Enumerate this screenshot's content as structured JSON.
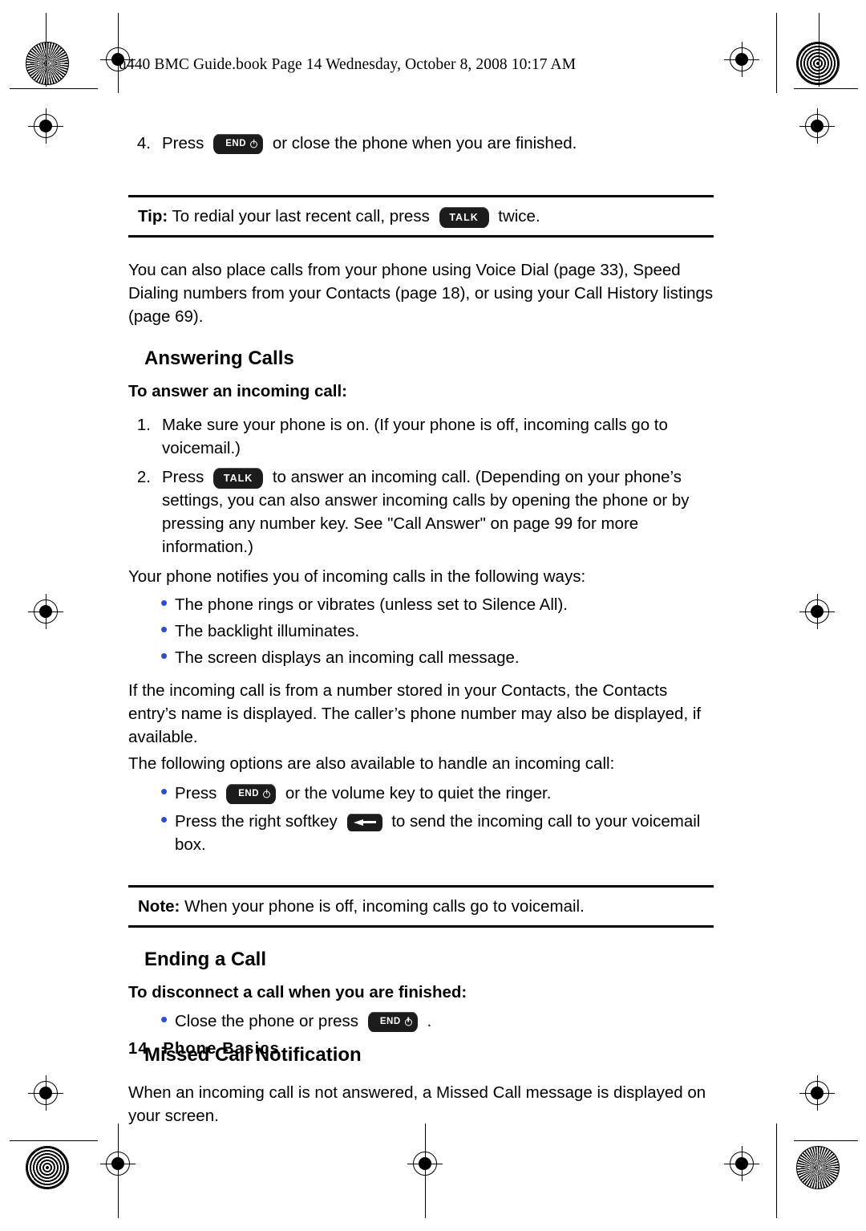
{
  "header": {
    "file_line": "u440 BMC Guide.book  Page 14  Wednesday, October 8, 2008  10:17 AM"
  },
  "content": {
    "step4": {
      "number": "4.",
      "text_before": "Press",
      "key": "END",
      "text_after": "or close the phone when you are finished."
    },
    "tip": {
      "label": "Tip:",
      "text_before": "To redial your last recent call, press",
      "key": "TALK",
      "text_after": "twice."
    },
    "intro_paragraph": "You can also place calls from your phone using Voice Dial (page 33), Speed Dialing numbers from your Contacts (page 18), or using your Call History listings (page 69).",
    "answering_calls_heading": "Answering Calls",
    "to_answer_subheading": "To answer an incoming call:",
    "answer_steps": [
      {
        "number": "1.",
        "text": "Make sure your phone is on. (If your phone is off, incoming calls go to voicemail.)"
      },
      {
        "number": "2.",
        "text_before": "Press",
        "key": "TALK",
        "text_after": "to answer an incoming call. (Depending on your phone’s settings, you can also answer incoming calls by opening the phone or by pressing any number key. See \"Call Answer\" on page 99 for more information.)"
      }
    ],
    "notify_lead": "Your phone notifies you of incoming calls in the following ways:",
    "notify_bullets": [
      "The phone rings or vibrates (unless set to Silence All).",
      "The backlight illuminates.",
      "The screen displays an incoming call message."
    ],
    "contacts_paragraph": "If the incoming call is from a number stored in your Contacts, the Contacts entry’s name is displayed. The caller’s phone number may also be displayed, if available.",
    "options_lead": "The following options are also available to handle an incoming call:",
    "option_bullets": [
      {
        "text_before": "Press",
        "key": "END",
        "text_after": "or the volume key to quiet the ringer."
      },
      {
        "text_before": "Press the right softkey",
        "key": "SOFTKEY",
        "text_after": "to send the incoming call to your voicemail box."
      }
    ],
    "note": {
      "label": "Note:",
      "text": "When your phone is off, incoming calls go to voicemail."
    },
    "ending_call_heading": "Ending a Call",
    "disconnect_subheading": "To disconnect a call when you are finished:",
    "disconnect_bullet": {
      "text_before": "Close the phone or press",
      "key": "END",
      "text_after": "."
    },
    "missed_call_heading": "Missed Call Notification",
    "missed_call_paragraph": "When an incoming call is not answered, a Missed Call message is displayed on your screen."
  },
  "footer": {
    "page_number": "14",
    "section": "Phone Basics"
  },
  "colors": {
    "bullet": "#2a4ed6",
    "key_background": "#1c1c1c",
    "text": "#000000"
  }
}
